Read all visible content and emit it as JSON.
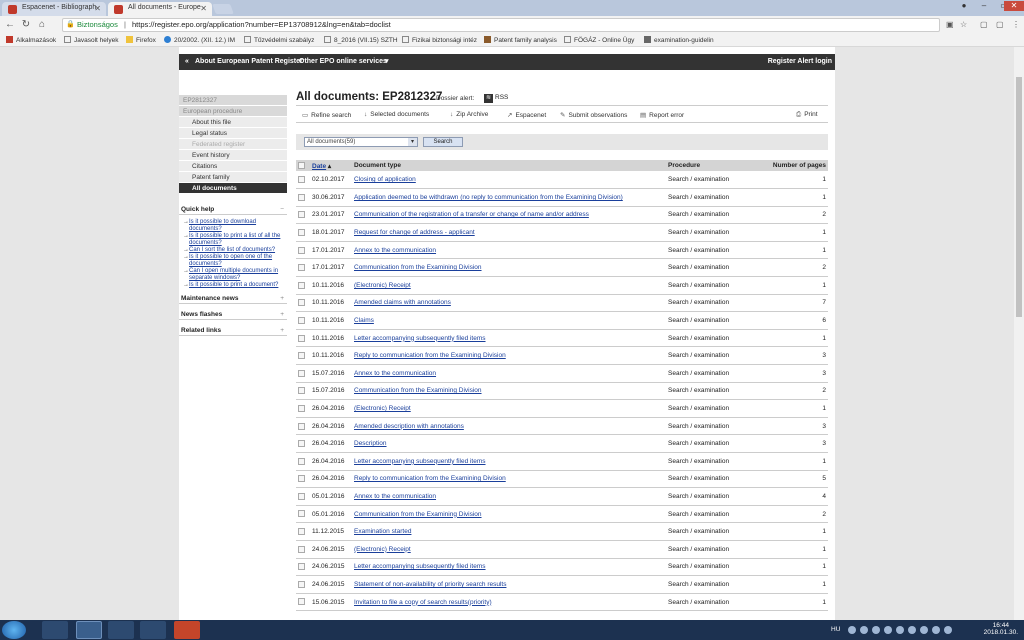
{
  "browser": {
    "tabs": [
      {
        "label": "Espacenet - Bibliograph",
        "color": "#c0392b"
      },
      {
        "label": "All documents - Europe",
        "color": "#c0392b"
      }
    ],
    "url_secure": "Biztonságos",
    "url_text": "https://register.epo.org/application?number=EP13708912&lng=en&tab=doclist",
    "bookmarks": [
      "Alkalmazások",
      "Javasolt helyek",
      "Firefox",
      "20/2002. (XII. 12.) IM",
      "Tűzvédelmi szabályz",
      "8_2016 (VII.15) SZTH",
      "Fizikai biztonsági intéz",
      "Patent family analysis",
      "FÖGÁZ - Online Ügy",
      "examination-guidelin"
    ]
  },
  "topnav": {
    "about": "About European Patent Register",
    "other": "Other EPO online services",
    "alert_login": "Register Alert login"
  },
  "sidebar": {
    "file_number": "EP2812327",
    "section": "European procedure",
    "items": [
      {
        "label": "About this file",
        "state": "normal"
      },
      {
        "label": "Legal status",
        "state": "normal"
      },
      {
        "label": "Federated register",
        "state": "disabled"
      },
      {
        "label": "Event history",
        "state": "normal"
      },
      {
        "label": "Citations",
        "state": "normal"
      },
      {
        "label": "Patent family",
        "state": "normal"
      },
      {
        "label": "All documents",
        "state": "active"
      }
    ],
    "quick_help": "Quick help",
    "help_links": [
      "Is it possible to download documents?",
      "Is it possible to print a list of all the documents?",
      "Can I sort the list of documents?",
      "Is it possible to open one of the documents?",
      "Can I open multiple documents in separate windows?",
      "Is it possible to print a document?"
    ],
    "maintenance": "Maintenance news",
    "news": "News flashes",
    "related": "Related links"
  },
  "main": {
    "title": "All documents: EP2812327",
    "dossier_alert": "Dossier alert:",
    "rss": "RSS",
    "toolbar": {
      "refine": "Refine search",
      "selected": "Selected documents",
      "zip": "Zip Archive",
      "espacenet": "Espacenet",
      "submit": "Submit observations",
      "report": "Report error",
      "print": "Print"
    },
    "filter_value": "All documents(59)",
    "search_label": "Search",
    "columns": {
      "date": "Date",
      "doctype": "Document type",
      "procedure": "Procedure",
      "pages": "Number of pages"
    },
    "rows": [
      [
        "02.10.2017",
        "Closing of application",
        "Search / examination",
        "1"
      ],
      [
        "30.06.2017",
        "Application deemed to be withdrawn (no reply to communication from the Examining Division)",
        "Search / examination",
        "1"
      ],
      [
        "23.01.2017",
        "Communication of the registration of a transfer or change of name and/or address",
        "Search / examination",
        "2"
      ],
      [
        "18.01.2017",
        "Request for change of address - applicant",
        "Search / examination",
        "1"
      ],
      [
        "17.01.2017",
        "Annex to the communication",
        "Search / examination",
        "1"
      ],
      [
        "17.01.2017",
        "Communication from the Examining Division",
        "Search / examination",
        "2"
      ],
      [
        "10.11.2016",
        "(Electronic) Receipt",
        "Search / examination",
        "1"
      ],
      [
        "10.11.2016",
        "Amended claims with annotations",
        "Search / examination",
        "7"
      ],
      [
        "10.11.2016",
        "Claims",
        "Search / examination",
        "6"
      ],
      [
        "10.11.2016",
        "Letter accompanying subsequently filed items",
        "Search / examination",
        "1"
      ],
      [
        "10.11.2016",
        "Reply to communication from the Examining Division",
        "Search / examination",
        "3"
      ],
      [
        "15.07.2016",
        "Annex to the communication",
        "Search / examination",
        "3"
      ],
      [
        "15.07.2016",
        "Communication from the Examining Division",
        "Search / examination",
        "2"
      ],
      [
        "26.04.2016",
        "(Electronic) Receipt",
        "Search / examination",
        "1"
      ],
      [
        "26.04.2016",
        "Amended description with annotations",
        "Search / examination",
        "3"
      ],
      [
        "26.04.2016",
        "Description",
        "Search / examination",
        "3"
      ],
      [
        "26.04.2016",
        "Letter accompanying subsequently filed items",
        "Search / examination",
        "1"
      ],
      [
        "26.04.2016",
        "Reply to communication from the Examining Division",
        "Search / examination",
        "5"
      ],
      [
        "05.01.2016",
        "Annex to the communication",
        "Search / examination",
        "4"
      ],
      [
        "05.01.2016",
        "Communication from the Examining Division",
        "Search / examination",
        "2"
      ],
      [
        "11.12.2015",
        "Examination started",
        "Search / examination",
        "1"
      ],
      [
        "24.06.2015",
        "(Electronic) Receipt",
        "Search / examination",
        "1"
      ],
      [
        "24.06.2015",
        "Letter accompanying subsequently filed items",
        "Search / examination",
        "1"
      ],
      [
        "24.06.2015",
        "Statement of non-availability of priority search results",
        "Search / examination",
        "1"
      ],
      [
        "15.06.2015",
        "Invitation to file a copy of search results(priority)",
        "Search / examination",
        "1"
      ]
    ]
  },
  "taskbar": {
    "lang": "HU",
    "time": "16:44",
    "date": "2018.01.30."
  }
}
